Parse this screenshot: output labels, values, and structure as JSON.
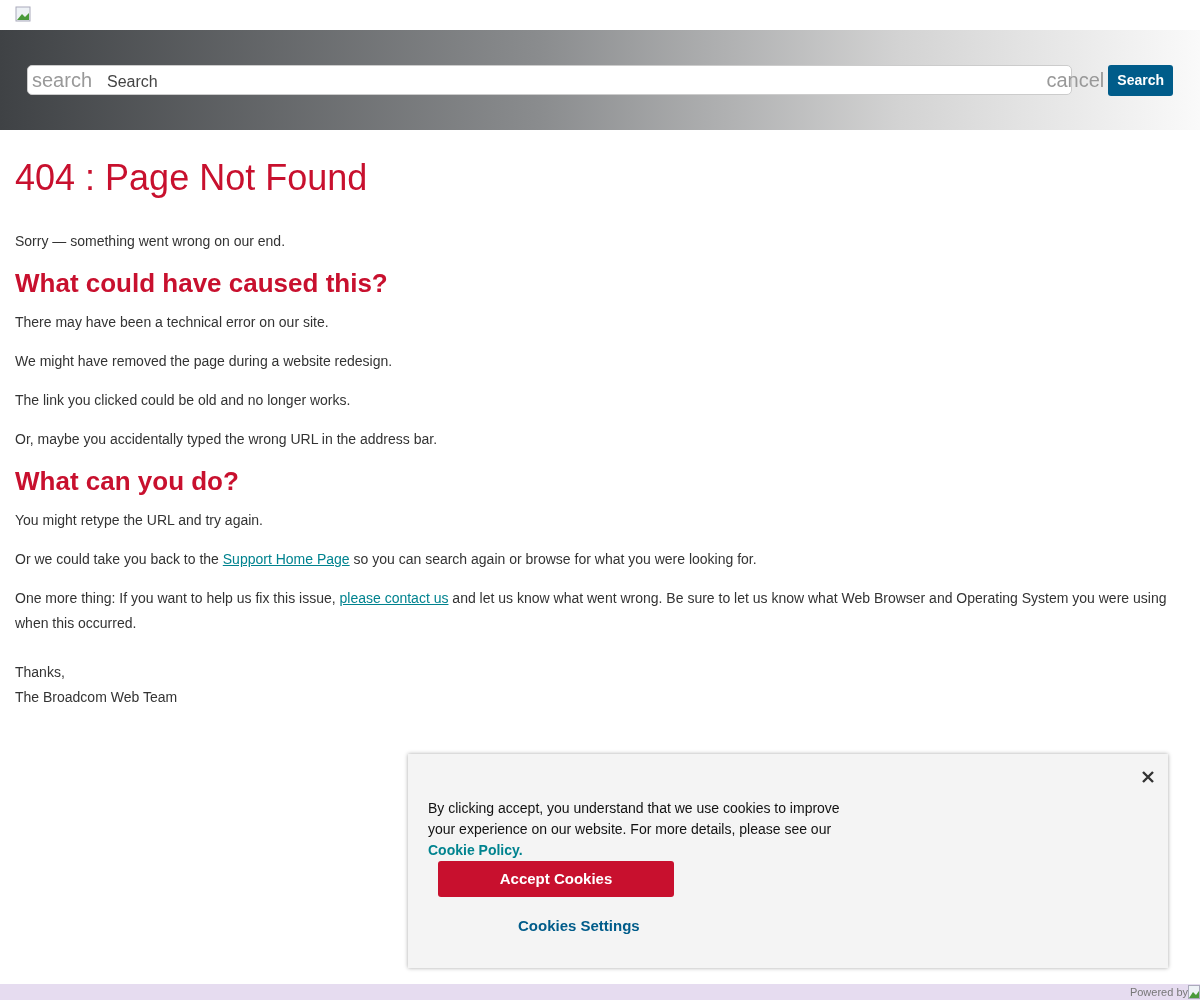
{
  "search": {
    "placeholder": "search",
    "label": "Search",
    "cancel": "cancel",
    "button": "Search"
  },
  "title": "404 : Page Not Found",
  "intro": "Sorry — something went wrong on our end.",
  "sections": [
    {
      "heading": "What could have caused this?",
      "paragraphs": [
        {
          "parts": [
            {
              "text": "There may have been a technical error on our site."
            }
          ]
        },
        {
          "parts": [
            {
              "text": "We might have removed the page during a website redesign."
            }
          ]
        },
        {
          "parts": [
            {
              "text": "The link you clicked could be old and no longer works."
            }
          ]
        },
        {
          "parts": [
            {
              "text": "Or, maybe you accidentally typed the wrong URL in the address bar."
            }
          ]
        }
      ]
    },
    {
      "heading": "What can you do?",
      "paragraphs": [
        {
          "parts": [
            {
              "text": "You might retype the URL and try again."
            }
          ]
        },
        {
          "parts": [
            {
              "text": "Or we could take you back to the "
            },
            {
              "text": "Support Home Page",
              "kind": "link"
            },
            {
              "text": " so you can search again or browse for what you were looking for."
            }
          ]
        },
        {
          "parts": [
            {
              "text": "One more thing: If you want to help us fix this issue, "
            },
            {
              "text": "please contact us",
              "kind": "link"
            },
            {
              "text": " and let us know what went wrong. Be sure to let us know what Web Browser and Operating System you were using when this occurred."
            }
          ]
        }
      ]
    }
  ],
  "signoff": [
    "Thanks,",
    "The Broadcom Web Team"
  ],
  "cookie_banner": {
    "text": "By clicking accept, you understand that we use cookies to improve your experience on our website. For more details, please see our",
    "policy_link": "Cookie Policy.",
    "accept": "Accept Cookies",
    "settings": "Cookies Settings"
  },
  "footer": {
    "powered_by": "Powered by"
  }
}
